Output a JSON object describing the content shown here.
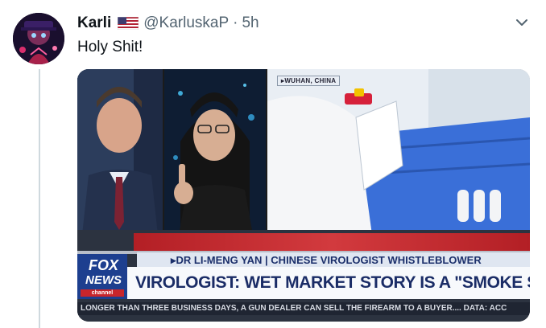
{
  "tweet": {
    "display_name": "Karli",
    "flag_icon": "us-flag-icon",
    "handle": "@KarluskaP",
    "separator": "·",
    "time": "5h",
    "text": "Holy Shit!",
    "menu_icon": "chevron-down-icon"
  },
  "video": {
    "location_tag": "▸WUHAN, CHINA",
    "subtitle": "▸DR LI-MENG YAN | CHINESE VIROLOGIST WHISTLEBLOWER",
    "headline": "VIROLOGIST: WET MARKET STORY IS A \"SMOKE SCREEN\"",
    "logo_top": "FOX",
    "logo_bottom": "NEWS",
    "logo_channel": "channel",
    "ticker": "LONGER THAN THREE BUSINESS DAYS, A GUN DEALER CAN SELL THE FIREARM TO A BUYER....  DATA: ACC"
  },
  "colors": {
    "fox_blue": "#1d3f8f",
    "fox_red": "#c8252b",
    "text_primary": "#0f1419",
    "text_secondary": "#536471"
  }
}
